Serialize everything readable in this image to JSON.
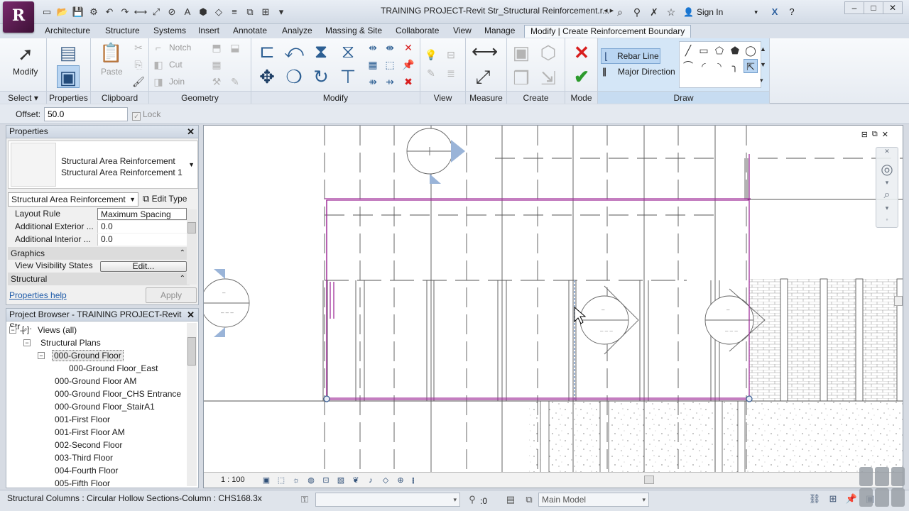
{
  "app": {
    "logo_letter": "R",
    "window_title": "TRAINING PROJECT-Revit Str_Structural Reinforcement.r...",
    "sign_in": "Sign In"
  },
  "tabs": [
    "Architecture",
    "Structure",
    "Systems",
    "Insert",
    "Annotate",
    "Analyze",
    "Massing & Site",
    "Collaborate",
    "View",
    "Manage",
    "Modify | Create Reinforcement Boundary"
  ],
  "ribbon": {
    "select": {
      "modify_label": "Modify",
      "panel_label": "Select"
    },
    "properties": {
      "panel_label": "Properties"
    },
    "clipboard": {
      "paste_label": "Paste",
      "panel_label": "Clipboard"
    },
    "geometry": {
      "notch_label": "Notch",
      "cut_label": "Cut",
      "join_label": "Join",
      "panel_label": "Geometry"
    },
    "modify": {
      "panel_label": "Modify"
    },
    "view": {
      "panel_label": "View"
    },
    "measure": {
      "panel_label": "Measure"
    },
    "create": {
      "panel_label": "Create"
    },
    "mode": {
      "panel_label": "Mode"
    },
    "draw": {
      "rebar_line_label": "Rebar Line",
      "major_direction_label": "Major Direction",
      "panel_label": "Draw"
    }
  },
  "options_bar": {
    "offset_label": "Offset:",
    "offset_value": "50.0",
    "lock_label": "Lock"
  },
  "properties": {
    "title": "Properties",
    "type_line1": "Structural Area Reinforcement",
    "type_line2": "Structural Area Reinforcement 1",
    "family_selector": "Structural Area Reinforcement",
    "edit_type": "Edit Type",
    "rows": [
      {
        "key": "Layout Rule",
        "value": "Maximum Spacing"
      },
      {
        "key": "Additional Exterior ...",
        "value": "0.0"
      },
      {
        "key": "Additional Interior ...",
        "value": "0.0"
      }
    ],
    "group_graphics": "Graphics",
    "vis_states_label": "View Visibility States",
    "edit_button": "Edit...",
    "group_structural": "Structural",
    "help_link": "Properties help",
    "apply_button": "Apply"
  },
  "browser": {
    "title": "Project Browser - TRAINING PROJECT-Revit Str_...",
    "items": [
      "Views (all)",
      "Structural Plans",
      "000-Ground Floor",
      "000-Ground Floor_East",
      "000-Ground Floor AM",
      "000-Ground Floor_CHS Entrance",
      "000-Ground Floor_StairA1",
      "001-First Floor",
      "001-First Floor AM",
      "002-Second Floor",
      "003-Third Floor",
      "004-Fourth Floor",
      "005-Fifth Floor"
    ]
  },
  "view": {
    "scale": "1 : 100"
  },
  "statusbar": {
    "text": "Structural Columns : Circular Hollow Sections-Column : CHS168.3x",
    "selection_count": ":0",
    "model": "Main Model"
  },
  "colors": {
    "boundary": "#a0309a",
    "accent": "#3f7fcf",
    "delete_red": "#d81e1e",
    "finish_green": "#2c9a2c"
  }
}
